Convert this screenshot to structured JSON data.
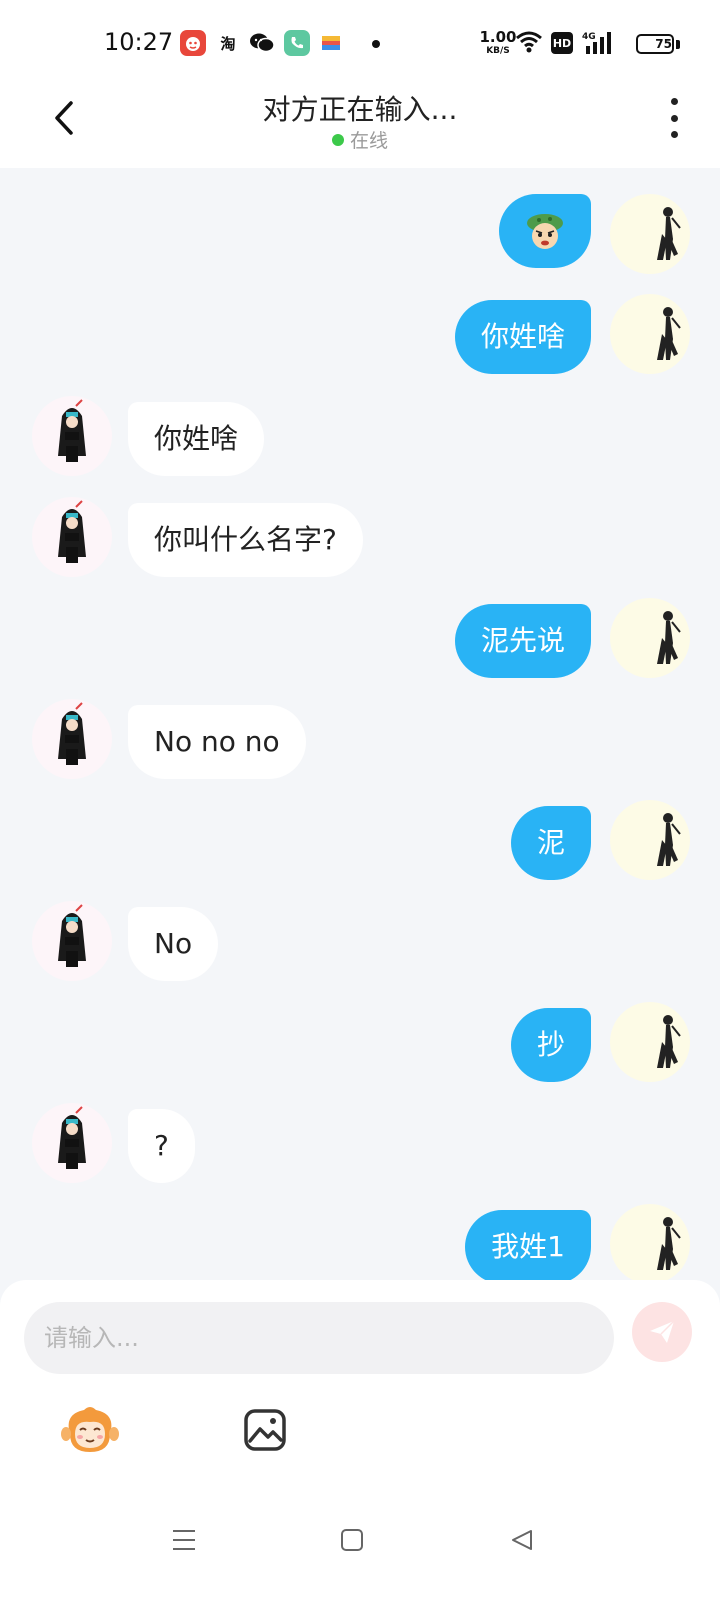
{
  "status_bar": {
    "time": "10:27",
    "taobao_label": "淘",
    "net_speed_value": "1.00",
    "net_speed_unit": "KB/S",
    "hd_label": "HD",
    "signal_label": "4G",
    "battery": "75"
  },
  "header": {
    "title": "对方正在输入...",
    "status": "在线"
  },
  "messages": [
    {
      "from": "me",
      "type": "sticker",
      "sticker": "green-hat-face-sticker"
    },
    {
      "from": "me",
      "text": "你姓啥"
    },
    {
      "from": "other",
      "text": "你姓啥"
    },
    {
      "from": "other",
      "text": "你叫什么名字?"
    },
    {
      "from": "me",
      "text": "泥先说"
    },
    {
      "from": "other",
      "text": "No no no"
    },
    {
      "from": "me",
      "text": "泥"
    },
    {
      "from": "other",
      "text": "No"
    },
    {
      "from": "me",
      "text": "抄"
    },
    {
      "from": "other",
      "text": "?"
    },
    {
      "from": "me",
      "text": "我姓1"
    }
  ],
  "input": {
    "placeholder": "请输入..."
  },
  "toolbar": {
    "icons": [
      "monkey-emoji-icon",
      "image-picker-icon"
    ]
  },
  "colors": {
    "my_bubble": "#29b3f5",
    "other_bubble": "#ffffff",
    "chat_background": "#f4f6f9",
    "online_dot": "#3cc94a",
    "send_button": "#fde3e3"
  }
}
